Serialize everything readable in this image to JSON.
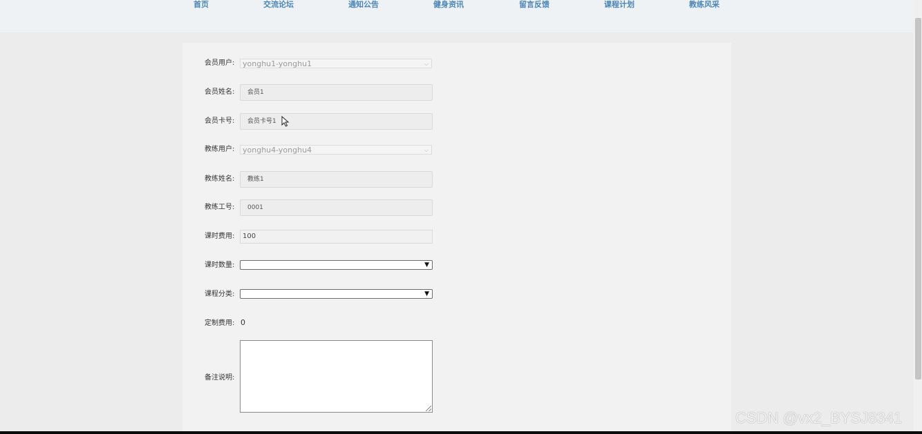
{
  "nav": {
    "items": [
      "首页",
      "交流论坛",
      "通知公告",
      "健身资讯",
      "留言反馈",
      "课程计划",
      "教练风采"
    ]
  },
  "form": {
    "member_user": {
      "label": "会员用户:",
      "value": "yonghu1-yonghu1"
    },
    "member_name": {
      "label": "会员姓名:",
      "value": "会员1"
    },
    "member_card": {
      "label": "会员卡号:",
      "value": "会员卡号1"
    },
    "coach_user": {
      "label": "教练用户:",
      "value": "yonghu4-yonghu4"
    },
    "coach_name": {
      "label": "教练姓名:",
      "value": "教练1"
    },
    "coach_id": {
      "label": "教练工号:",
      "value": "0001"
    },
    "lesson_fee": {
      "label": "课时费用:",
      "value": "100"
    },
    "lesson_count": {
      "label": "课时数量:",
      "value": ""
    },
    "course_category": {
      "label": "课程分类:",
      "value": ""
    },
    "custom_fee": {
      "label": "定制费用:",
      "value": "0"
    },
    "remarks": {
      "label": "备注说明:",
      "value": ""
    }
  },
  "watermark": "CSDN @vx2_BYSJ8341",
  "colors": {
    "nav_text": "#4a86b8",
    "page_bg": "#ececec",
    "header_bg": "#eef2f4"
  }
}
